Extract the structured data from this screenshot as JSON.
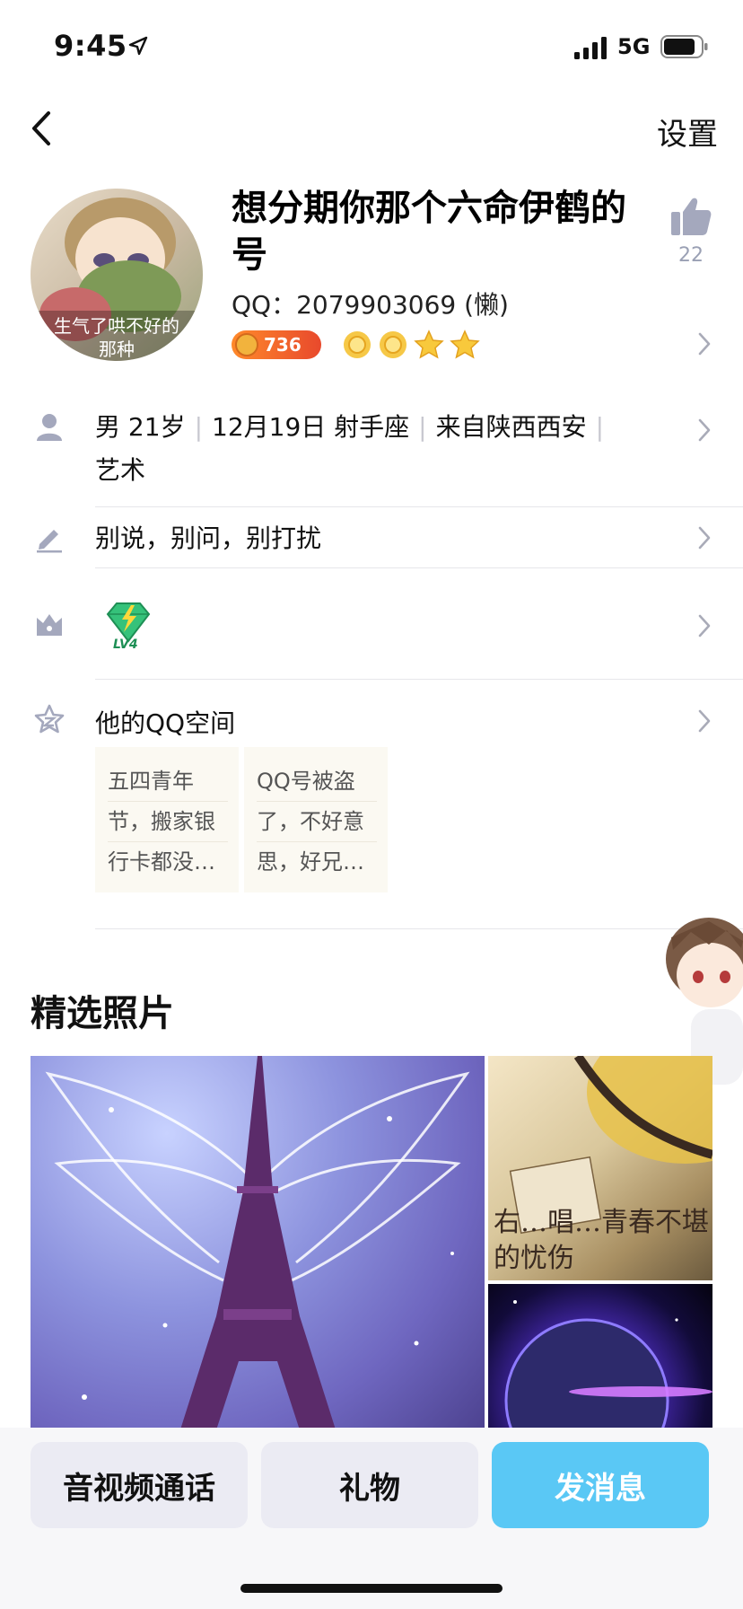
{
  "status_bar": {
    "time": "9:45",
    "network": "5G"
  },
  "nav": {
    "settings_label": "设置"
  },
  "profile": {
    "avatar_caption_line1": "生气了哄不好的",
    "avatar_caption_line2": "那种",
    "nickname": "想分期你那个六命伊鹤的号",
    "qq_line": "QQ：2079903069 (懒)",
    "level_value": "736",
    "like_count": "22",
    "stars": [
      "sun",
      "sun",
      "star",
      "star"
    ]
  },
  "info": {
    "gender": "男",
    "age": "21岁",
    "birthday": "12月19日 射手座",
    "hometown": "来自陕西西安",
    "occupation": "艺术",
    "signature": "别说，别问，别打扰",
    "vip_label": "LV4"
  },
  "space": {
    "title": "他的QQ空间",
    "cards": [
      {
        "lines": [
          "五四青年",
          "节，搬家银",
          "行卡都没…"
        ]
      },
      {
        "lines": [
          "QQ号被盗",
          "了，不好意",
          "思，好兄…"
        ]
      }
    ]
  },
  "photos": {
    "section_title": "精选照片",
    "guitar_caption": "右…唱…青春不堪的忧伤"
  },
  "actions": {
    "call_label": "音视频通话",
    "gift_label": "礼物",
    "message_label": "发消息"
  },
  "colors": {
    "accent": "#5ac8f5",
    "level_badge": "#e8492c",
    "muted_icon": "#9aa0b4"
  }
}
